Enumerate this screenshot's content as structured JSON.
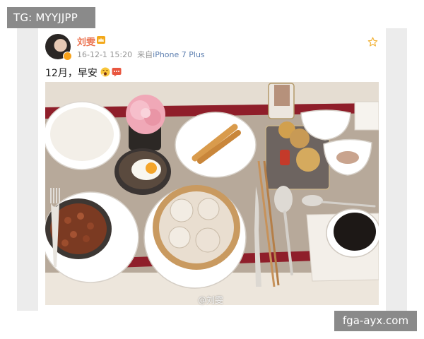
{
  "overlay": {
    "top_left_tag": "TG: MYYJJPP",
    "bottom_right_tag": "fga-ayx.com"
  },
  "post": {
    "username": "刘雯",
    "timestamp": "16-12-1 15:20",
    "source_prefix": "来自",
    "source_device": "iPhone 7 Plus",
    "text": "12月，早安",
    "image_watermark": "@刘雯"
  },
  "icons": {
    "verified_badge": "verified-badge-icon",
    "membership": "crown-icon",
    "favorite": "star-outline-icon",
    "emoji_1": "yawn-emoji-icon",
    "emoji_2": "speech-bubble-emoji-icon"
  },
  "colors": {
    "username": "#eb7350",
    "source_link": "#5d7fb0",
    "meta": "#939393",
    "tag_background": "#8a8a8a",
    "star": "#f2b43c"
  }
}
